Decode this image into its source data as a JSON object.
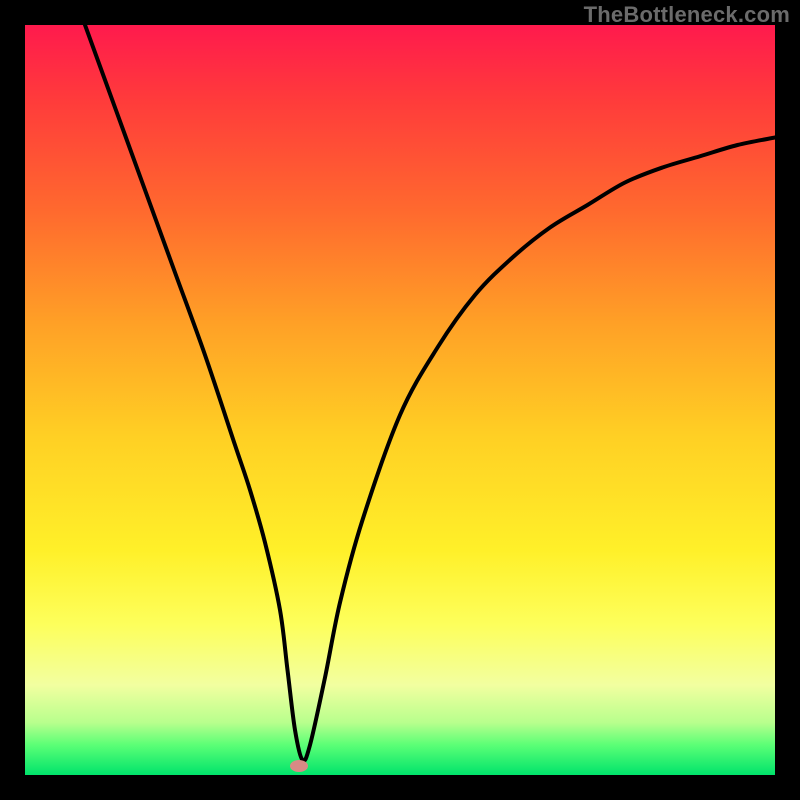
{
  "watermark": "TheBottleneck.com",
  "chart_data": {
    "type": "line",
    "title": "",
    "xlabel": "",
    "ylabel": "",
    "xlim": [
      0,
      100
    ],
    "ylim": [
      0,
      100
    ],
    "series": [
      {
        "name": "curve",
        "x": [
          8,
          12,
          16,
          20,
          24,
          28,
          30,
          32,
          34,
          35,
          36,
          37,
          38,
          40,
          42,
          45,
          50,
          55,
          60,
          65,
          70,
          75,
          80,
          85,
          90,
          95,
          100
        ],
        "y": [
          100,
          89,
          78,
          67,
          56,
          44,
          38,
          31,
          22,
          14,
          6,
          2,
          4,
          13,
          23,
          34,
          48,
          57,
          64,
          69,
          73,
          76,
          79,
          81,
          82.5,
          84,
          85
        ]
      }
    ],
    "marker": {
      "x": 36.5,
      "y": 1.2
    },
    "gradient_stops": [
      {
        "pct": 0,
        "color": "#ff1a4d"
      },
      {
        "pct": 10,
        "color": "#ff3b3b"
      },
      {
        "pct": 25,
        "color": "#ff6a2e"
      },
      {
        "pct": 40,
        "color": "#ffa126"
      },
      {
        "pct": 55,
        "color": "#ffd024"
      },
      {
        "pct": 70,
        "color": "#fff029"
      },
      {
        "pct": 80,
        "color": "#fdff5c"
      },
      {
        "pct": 88,
        "color": "#f2ffa0"
      },
      {
        "pct": 93,
        "color": "#b8ff8d"
      },
      {
        "pct": 96,
        "color": "#5bff76"
      },
      {
        "pct": 100,
        "color": "#00e36b"
      }
    ]
  }
}
